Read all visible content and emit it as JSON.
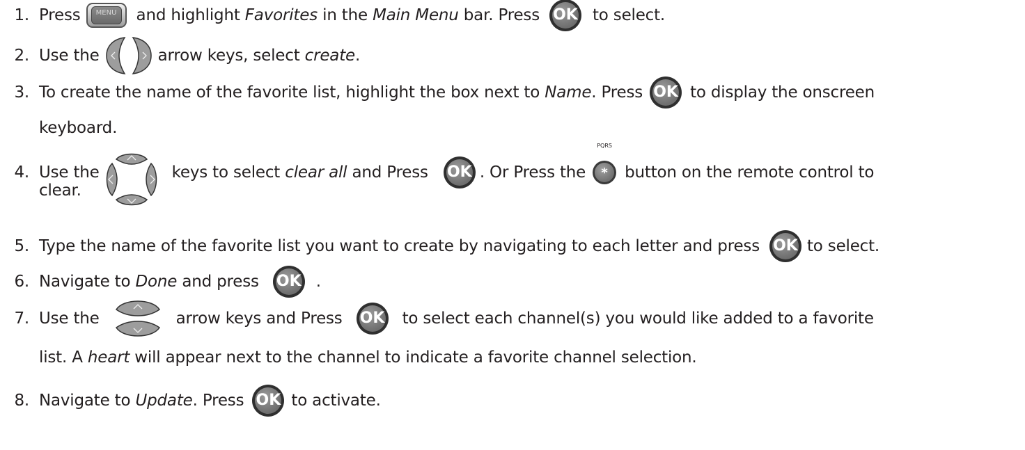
{
  "buttons": {
    "menu_label": "MENU",
    "ok_label": "OK",
    "star_label": "*",
    "star_letters": "PQRS"
  },
  "steps": [
    {
      "num": "1.",
      "a": "Press",
      "b": "and highlight",
      "c": "Favorites",
      "d": "in the",
      "e": "Main Menu",
      "f": "bar. Press",
      "g": "to select."
    },
    {
      "num": "2.",
      "a": "Use the",
      "b": "arrow keys, select",
      "c": "create",
      "d": "."
    },
    {
      "num": "3.",
      "a": "To create the name of the favorite list, highlight the box next to",
      "b": "Name",
      "c": ". Press",
      "d": "to display the onscreen",
      "e": "keyboard."
    },
    {
      "num": "4.",
      "a": "Use the",
      "b": "keys to select",
      "c": "clear all",
      "d": "and Press",
      "e": ". Or Press the",
      "f": "button on the remote control to",
      "g": "clear."
    },
    {
      "num": "5.",
      "a": "Type the name of the favorite list you want to create by navigating to each letter and press",
      "b": "to select."
    },
    {
      "num": "6.",
      "a": "Navigate to",
      "b": "Done",
      "c": "and press",
      "d": "."
    },
    {
      "num": "7.",
      "a": "Use the",
      "b": "arrow keys and Press",
      "c": "to select each channel(s) you would like added to a favorite",
      "d": "list. A",
      "e": "heart",
      "f": "will appear next to the channel to indicate a favorite channel selection."
    },
    {
      "num": "8.",
      "a": "Navigate to",
      "b": "Update",
      "c": ". Press",
      "d": "to activate."
    }
  ]
}
